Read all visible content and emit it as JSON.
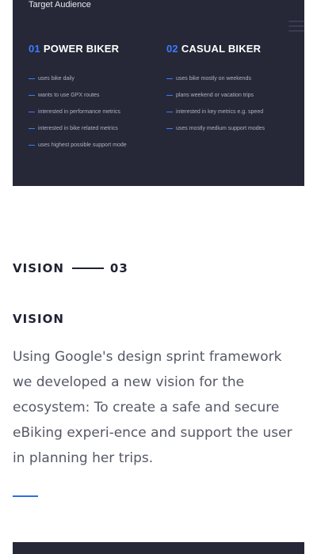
{
  "hero": {
    "audience_title": "Target Audience",
    "personas": [
      {
        "number": "01",
        "name": "POWER BIKER",
        "traits": [
          "uses bike daily",
          "wants to use GPX routes",
          "interested in performance metrics",
          "interested in bike related metrics",
          "uses highest possible support mode"
        ]
      },
      {
        "number": "02",
        "name": "CASUAL BIKER",
        "traits": [
          "uses bike mostly on weekends",
          "plans weekend or vacation trips",
          "interested in key metrics e.g. speed",
          "uses mostly medium support modes"
        ]
      }
    ]
  },
  "section": {
    "label": "VISION",
    "number": "03"
  },
  "vision": {
    "heading": "VISION",
    "body": "Using Google's design sprint framework we developed a new vision for the ecosystem: To create a safe and secure eBiking experi-ence and support the user in planning her trips."
  },
  "colors": {
    "card_bg": "#262838",
    "accent": "#3d7bff",
    "text_dark": "#1f2233",
    "text_body": "#555866"
  },
  "icons": {
    "menu": "hamburger-menu-icon"
  }
}
